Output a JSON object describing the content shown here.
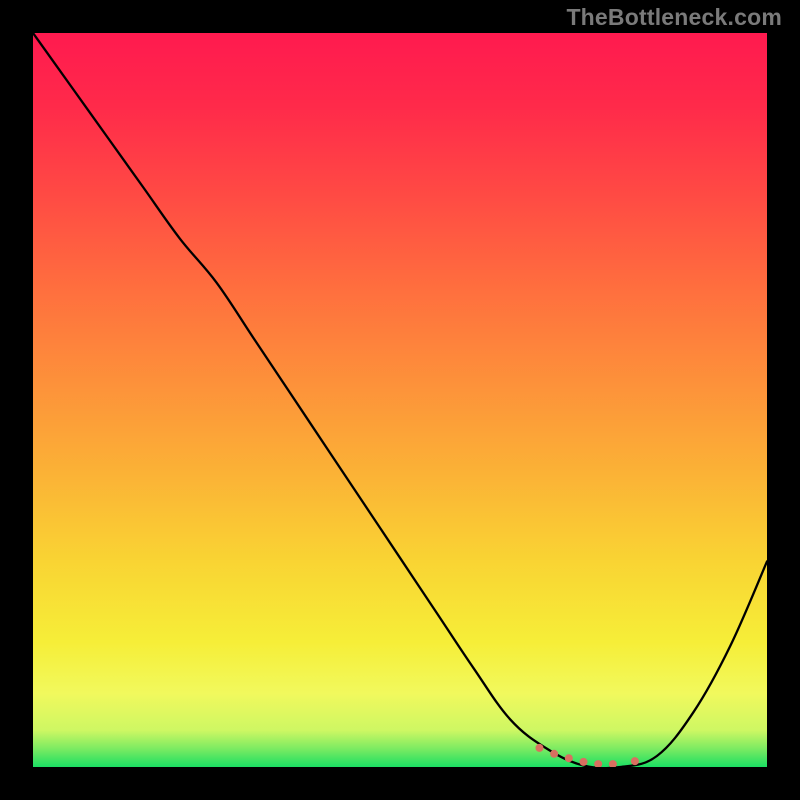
{
  "watermark": "TheBottleneck.com",
  "chart_data": {
    "type": "line",
    "title": "",
    "xlabel": "",
    "ylabel": "",
    "x": [
      0.0,
      0.05,
      0.1,
      0.15,
      0.2,
      0.25,
      0.3,
      0.35,
      0.4,
      0.45,
      0.5,
      0.55,
      0.6,
      0.65,
      0.7,
      0.75,
      0.8,
      0.85,
      0.9,
      0.95,
      1.0
    ],
    "values": [
      1.0,
      0.93,
      0.86,
      0.79,
      0.72,
      0.66,
      0.585,
      0.51,
      0.435,
      0.36,
      0.285,
      0.21,
      0.135,
      0.065,
      0.025,
      0.002,
      0.0,
      0.015,
      0.075,
      0.165,
      0.28
    ],
    "xlim": [
      0,
      1
    ],
    "ylim": [
      0,
      1
    ],
    "markers_x": [
      0.69,
      0.71,
      0.73,
      0.75,
      0.77,
      0.79,
      0.82
    ],
    "markers_y": [
      0.026,
      0.018,
      0.012,
      0.007,
      0.004,
      0.004,
      0.008
    ],
    "marker_color": "#d96f60",
    "line_color": "#000000",
    "gradient_stops": [
      {
        "offset": 0.0,
        "color": "#ff1a4f"
      },
      {
        "offset": 0.1,
        "color": "#ff2a4a"
      },
      {
        "offset": 0.22,
        "color": "#ff4a44"
      },
      {
        "offset": 0.35,
        "color": "#ff6f3e"
      },
      {
        "offset": 0.48,
        "color": "#fd923a"
      },
      {
        "offset": 0.6,
        "color": "#fbb236"
      },
      {
        "offset": 0.72,
        "color": "#f9d433"
      },
      {
        "offset": 0.83,
        "color": "#f6ee38"
      },
      {
        "offset": 0.9,
        "color": "#f1f95d"
      },
      {
        "offset": 0.95,
        "color": "#cef763"
      },
      {
        "offset": 0.975,
        "color": "#7ceb62"
      },
      {
        "offset": 1.0,
        "color": "#1bdf63"
      }
    ]
  }
}
